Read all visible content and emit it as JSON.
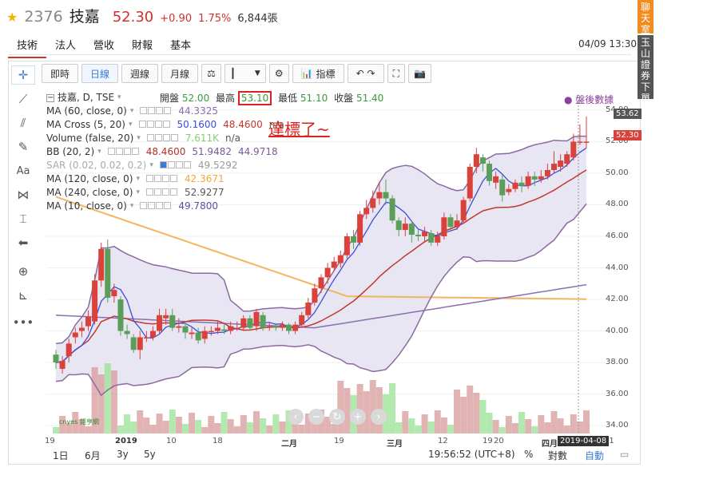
{
  "header": {
    "code": "2376",
    "name": "技嘉",
    "price": "52.30",
    "change": "+0.90",
    "change_pct": "1.75%",
    "volume": "6,844張"
  },
  "side_buttons": {
    "chat": "聊天室",
    "broker": "玉山證券下單"
  },
  "tabs": [
    "技術",
    "法人",
    "營收",
    "財報",
    "基本"
  ],
  "active_tab": "技術",
  "datetime": "04/09 13:30",
  "toolbar": {
    "intraday": "即時",
    "daily": "日線",
    "weekly": "週線",
    "monthly": "月線",
    "indicators": "指標"
  },
  "legend": {
    "title": "技嘉, D, TSE",
    "ohlc": {
      "open_label": "開盤",
      "open": "52.00",
      "high_label": "最高",
      "high": "53.10",
      "low_label": "最低",
      "low": "51.10",
      "close_label": "收盤",
      "close": "51.40"
    },
    "after_hours": "盤後數據",
    "rows": [
      {
        "name": "MA (60, close, 0)",
        "values": [
          "44.3325"
        ],
        "colors": [
          "#8a6fb0"
        ]
      },
      {
        "name": "MA Cross (5, 20)",
        "values": [
          "50.1600",
          "48.4600",
          "n/a"
        ],
        "colors": [
          "#3b4fd8",
          "#c0392b",
          "#555"
        ]
      },
      {
        "name": "Volume (false, 20)",
        "values": [
          "7.611K",
          "n/a"
        ],
        "colors": [
          "#7ed36e",
          "#555"
        ]
      },
      {
        "name": "BB (20, 2)",
        "values": [
          "48.4600",
          "51.9482",
          "44.9718"
        ],
        "colors": [
          "#b03030",
          "#7a5a9a",
          "#7a5a9a"
        ]
      },
      {
        "name": "SAR (0.02, 0.02, 0.2)",
        "values": [
          "49.5292"
        ],
        "colors": [
          "#999"
        ]
      },
      {
        "name": "MA (120, close, 0)",
        "values": [
          "42.3671"
        ],
        "colors": [
          "#f2a93b"
        ]
      },
      {
        "name": "MA (240, close, 0)",
        "values": [
          "52.9277"
        ],
        "colors": [
          "#555"
        ]
      },
      {
        "name": "MA (10, close, 0)",
        "values": [
          "49.7800"
        ],
        "colors": [
          "#5a4fa0"
        ]
      }
    ]
  },
  "annotation": "達標了~",
  "yaxis_ticks": [
    "54.00",
    "52.00",
    "50.00",
    "48.00",
    "46.00",
    "44.00",
    "42.00",
    "40.00",
    "38.00",
    "36.00",
    "34.00"
  ],
  "price_tags": {
    "high": "53.62",
    "last": "52.30"
  },
  "xaxis_ticks": [
    "19",
    "2019",
    "10",
    "18",
    "二月",
    "19",
    "三月",
    "12",
    "19",
    "20",
    "四月",
    "11"
  ],
  "date_tag": "2019-04-08",
  "bottom": {
    "ranges": [
      "1日",
      "6月",
      "3y",
      "5y"
    ],
    "time": "19:56:52 (UTC+8)",
    "pct": "%",
    "log": "對數",
    "auto": "自動"
  },
  "logo_text": "cnyes 鉅亨網",
  "colors": {
    "up": "#d9413a",
    "down": "#5a9e5a",
    "bb_fill": "#e8e6f3",
    "accent": "#3a7bd5"
  },
  "chart_data": {
    "type": "candlestick",
    "ylim": [
      33.5,
      54.5
    ],
    "candles": [
      [
        38.5,
        38.0,
        38.8,
        37.6
      ],
      [
        37.6,
        38.1,
        38.4,
        37.3
      ],
      [
        38.4,
        39.2,
        39.5,
        38.0
      ],
      [
        39.6,
        39.9,
        40.2,
        39.2
      ],
      [
        40.0,
        40.2,
        40.6,
        39.6
      ],
      [
        40.3,
        40.9,
        41.3,
        40.0
      ],
      [
        40.6,
        43.2,
        43.6,
        40.4
      ],
      [
        43.2,
        45.2,
        45.6,
        42.8
      ],
      [
        45.2,
        42.1,
        45.8,
        41.8
      ],
      [
        42.2,
        42.6,
        43.0,
        41.8
      ],
      [
        42.0,
        40.0,
        42.2,
        39.7
      ],
      [
        40.0,
        39.8,
        40.4,
        39.5
      ],
      [
        39.6,
        38.8,
        39.8,
        38.6
      ],
      [
        38.8,
        39.6,
        40.0,
        38.2
      ],
      [
        39.6,
        39.6,
        40.0,
        39.3
      ],
      [
        39.6,
        40.0,
        40.3,
        39.4
      ],
      [
        40.0,
        41.0,
        41.4,
        39.8
      ],
      [
        40.8,
        41.0,
        41.4,
        40.4
      ],
      [
        41.0,
        40.2,
        41.4,
        40.0
      ],
      [
        40.2,
        40.3,
        40.8,
        39.9
      ],
      [
        40.3,
        39.9,
        40.5,
        39.5
      ],
      [
        39.8,
        39.9,
        40.2,
        39.5
      ],
      [
        39.9,
        39.4,
        40.2,
        39.2
      ],
      [
        39.5,
        40.0,
        40.3,
        39.2
      ],
      [
        40.0,
        40.0,
        40.3,
        39.7
      ],
      [
        40.0,
        40.2,
        40.6,
        39.8
      ],
      [
        40.1,
        40.0,
        40.4,
        39.8
      ],
      [
        40.0,
        40.3,
        40.6,
        39.8
      ],
      [
        40.2,
        40.2,
        40.6,
        40.0
      ],
      [
        40.2,
        40.8,
        41.0,
        40.0
      ],
      [
        40.8,
        40.2,
        41.0,
        40.0
      ],
      [
        40.3,
        41.2,
        41.4,
        40.0
      ],
      [
        41.0,
        40.2,
        41.2,
        40.0
      ],
      [
        40.2,
        40.3,
        40.5,
        40.0
      ],
      [
        40.3,
        40.2,
        40.5,
        40.0
      ],
      [
        40.2,
        40.4,
        40.6,
        40.0
      ],
      [
        40.4,
        40.0,
        40.5,
        39.8
      ],
      [
        40.0,
        40.4,
        40.6,
        39.8
      ],
      [
        40.4,
        41.0,
        41.2,
        40.2
      ],
      [
        41.0,
        41.8,
        42.1,
        40.8
      ],
      [
        41.8,
        42.7,
        43.0,
        41.6
      ],
      [
        42.7,
        43.4,
        43.6,
        42.4
      ],
      [
        43.4,
        44.0,
        44.3,
        43.0
      ],
      [
        44.0,
        44.4,
        44.7,
        43.8
      ],
      [
        44.3,
        44.8,
        45.1,
        44.0
      ],
      [
        44.8,
        46.0,
        46.2,
        44.6
      ],
      [
        46.0,
        45.6,
        46.4,
        45.2
      ],
      [
        45.6,
        47.4,
        47.6,
        45.4
      ],
      [
        47.4,
        47.8,
        48.3,
        47.1
      ],
      [
        47.8,
        48.4,
        48.9,
        47.5
      ],
      [
        48.4,
        48.8,
        49.4,
        48.0
      ],
      [
        48.8,
        48.4,
        49.6,
        48.0
      ],
      [
        48.4,
        47.0,
        48.6,
        46.8
      ],
      [
        47.0,
        46.4,
        47.2,
        46.0
      ],
      [
        46.4,
        46.8,
        47.2,
        46.0
      ],
      [
        46.8,
        46.1,
        47.0,
        45.6
      ],
      [
        46.1,
        46.0,
        46.4,
        45.7
      ],
      [
        46.0,
        46.3,
        46.6,
        45.6
      ],
      [
        46.2,
        45.6,
        46.4,
        45.4
      ],
      [
        45.6,
        46.0,
        46.3,
        45.4
      ],
      [
        46.0,
        47.2,
        47.5,
        45.8
      ],
      [
        47.2,
        46.6,
        47.4,
        46.3
      ],
      [
        46.6,
        47.0,
        47.4,
        46.4
      ],
      [
        47.0,
        48.3,
        48.5,
        46.8
      ],
      [
        48.4,
        50.4,
        50.6,
        48.2
      ],
      [
        50.4,
        51.2,
        51.6,
        50.0
      ],
      [
        51.0,
        50.6,
        51.2,
        50.1
      ],
      [
        50.6,
        49.5,
        50.8,
        49.2
      ],
      [
        49.4,
        49.8,
        50.1,
        49.0
      ],
      [
        49.6,
        48.6,
        49.9,
        48.2
      ],
      [
        48.8,
        49.0,
        49.3,
        48.6
      ],
      [
        49.0,
        49.4,
        49.6,
        48.8
      ],
      [
        49.4,
        49.2,
        49.8,
        48.8
      ],
      [
        49.2,
        49.8,
        50.1,
        49.0
      ],
      [
        49.8,
        49.6,
        50.1,
        49.2
      ],
      [
        49.6,
        49.8,
        50.2,
        49.4
      ],
      [
        49.8,
        50.2,
        50.6,
        49.6
      ],
      [
        50.2,
        50.6,
        51.4,
        50.0
      ],
      [
        50.4,
        50.8,
        51.2,
        50.1
      ],
      [
        50.6,
        51.2,
        51.4,
        50.4
      ],
      [
        51.0,
        52.0,
        52.5,
        50.8
      ],
      [
        52.0,
        52.0,
        53.1,
        51.8
      ],
      [
        52.0,
        52.0,
        53.6,
        51.6
      ]
    ]
  }
}
